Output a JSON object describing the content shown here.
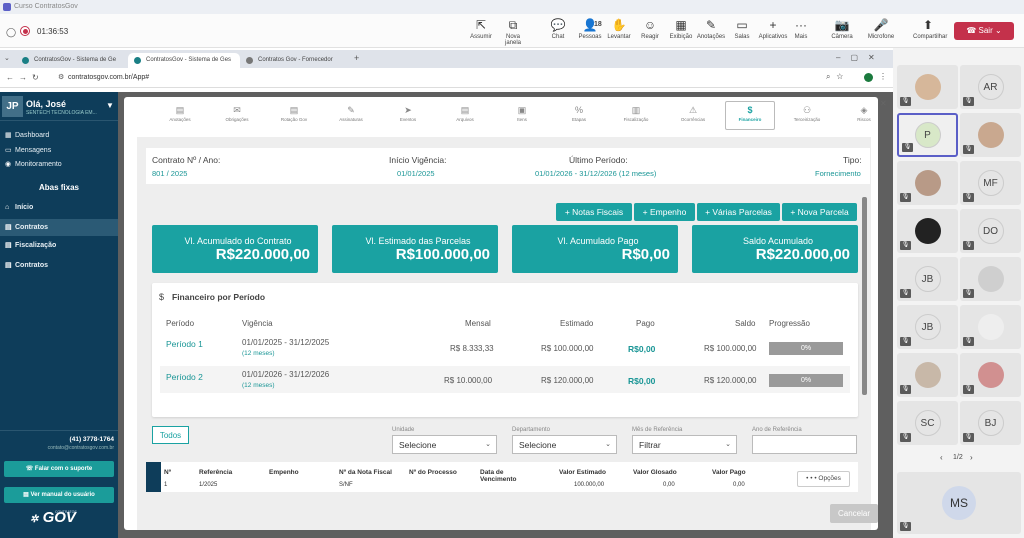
{
  "window": {
    "title": "Curso ContratosGov"
  },
  "meeting": {
    "timer": "01:36:53",
    "tools": [
      {
        "label": "Assumir",
        "icon": "⇱"
      },
      {
        "label": "Nova janela",
        "icon": "⧉"
      },
      {
        "label": "Chat",
        "icon": "💬"
      },
      {
        "label": "Pessoas",
        "icon": "👤",
        "count": "18"
      },
      {
        "label": "Levantar",
        "icon": "✋"
      },
      {
        "label": "Reagir",
        "icon": "☺"
      },
      {
        "label": "Exibição",
        "icon": "▦"
      },
      {
        "label": "Anotações",
        "icon": "✎"
      },
      {
        "label": "Salas",
        "icon": "▭"
      },
      {
        "label": "Aplicativos",
        "icon": "+"
      },
      {
        "label": "Mais",
        "icon": "···"
      },
      {
        "label": "Câmera",
        "icon": "📷"
      },
      {
        "label": "Microfone",
        "icon": "🎤"
      },
      {
        "label": "Compartilhar",
        "icon": "⬆"
      }
    ],
    "leave_label": "Sair"
  },
  "browser": {
    "tabs": [
      "ContratosGov - Sistema de Ge",
      "ContratosGov - Sistema de Ges",
      "Contratos Gov - Fornecedor"
    ],
    "url": "contratosgov.com.br/App#"
  },
  "sidebar": {
    "avatar": "JP",
    "greeting": "Olá, José",
    "company": "SENTECH TECNOLOGIA EM...",
    "menu": [
      {
        "label": "Dashboard"
      },
      {
        "label": "Mensagens"
      },
      {
        "label": "Monitoramento"
      }
    ],
    "section": "Abas fixas",
    "fixed": [
      {
        "label": "Início"
      },
      {
        "label": "Contratos"
      },
      {
        "label": "Fiscalização"
      },
      {
        "label": "Contratos"
      }
    ],
    "phone": "(41) 3778-1764",
    "email": "contato@contratosgov.com.br",
    "support_label": "Falar com o suporte",
    "manual_label": "Ver manual do usuário",
    "logo": "GOV",
    "logo_small": "CONTRATOS"
  },
  "nav": [
    "Anotações",
    "Obrigações",
    "Rotação Gov",
    "Assinaturas",
    "Eventos",
    "Arquivos",
    "Itens",
    "Etapas",
    "Fiscalização",
    "Ocorrências",
    "Financeiro",
    "Terceirização",
    "Riscos"
  ],
  "contract": {
    "label_num": "Contrato Nº / Ano:",
    "num": "801 / 2025",
    "label_inicio": "Início Vigência:",
    "inicio": "01/01/2025",
    "label_ultimo": "Último Período:",
    "ultimo": "01/01/2026 - 31/12/2026 (12 meses)",
    "label_tipo": "Tipo:",
    "tipo": "Fornecimento"
  },
  "actions": [
    "Notas Fiscais",
    "Empenho",
    "Várias Parcelas",
    "Nova Parcela"
  ],
  "cards": [
    {
      "title": "Vl. Acumulado do Contrato",
      "value": "R$220.000,00"
    },
    {
      "title": "Vl. Estimado das Parcelas",
      "value": "R$100.000,00"
    },
    {
      "title": "Vl. Acumulado Pago",
      "value": "R$0,00"
    },
    {
      "title": "Saldo Acumulado",
      "value": "R$220.000,00"
    }
  ],
  "financeiro": {
    "title": "Financeiro por Período",
    "headers": [
      "Período",
      "Vigência",
      "Mensal",
      "Estimado",
      "Pago",
      "Saldo",
      "Progressão"
    ],
    "rows": [
      {
        "periodo": "Período 1",
        "vig": "01/01/2025 - 31/12/2025",
        "meses": "(12 meses)",
        "mensal": "R$ 8.333,33",
        "estimado": "R$ 100.000,00",
        "pago": "R$0,00",
        "saldo": "R$ 100.000,00",
        "prog": "0%"
      },
      {
        "periodo": "Período 2",
        "vig": "01/01/2026 - 31/12/2026",
        "meses": "(12 meses)",
        "mensal": "R$ 10.000,00",
        "estimado": "R$ 120.000,00",
        "pago": "R$0,00",
        "saldo": "R$ 120.000,00",
        "prog": "0%"
      }
    ]
  },
  "filters": {
    "todos": "Todos",
    "unidade_label": "Unidade",
    "unidade": "Selecione",
    "depto_label": "Departamento",
    "depto": "Selecione",
    "mes_label": "Mês de Referência",
    "mes": "Filtrar",
    "ano_label": "Ano de Referência",
    "ano": ""
  },
  "table": {
    "headers": [
      "Nº",
      "Referência",
      "Empenho",
      "Nº da Nota Fiscal",
      "Nº do Processo",
      "Data de Vencimento",
      "Valor Estimado",
      "Valor Glosado",
      "Valor Pago"
    ],
    "row": [
      "1",
      "1/2025",
      "",
      "S/NF",
      "",
      "",
      "100.000,00",
      "0,00",
      "0,00"
    ],
    "opcoes": "Opções"
  },
  "cancel": "Cancelar",
  "participants": {
    "tiles": [
      "",
      "AR",
      "P",
      "",
      "",
      "MF",
      "",
      "DO",
      "JB",
      "",
      "JB",
      "",
      "",
      "",
      "SC",
      "BJ"
    ],
    "page": "1/2",
    "bottom": "MS"
  }
}
